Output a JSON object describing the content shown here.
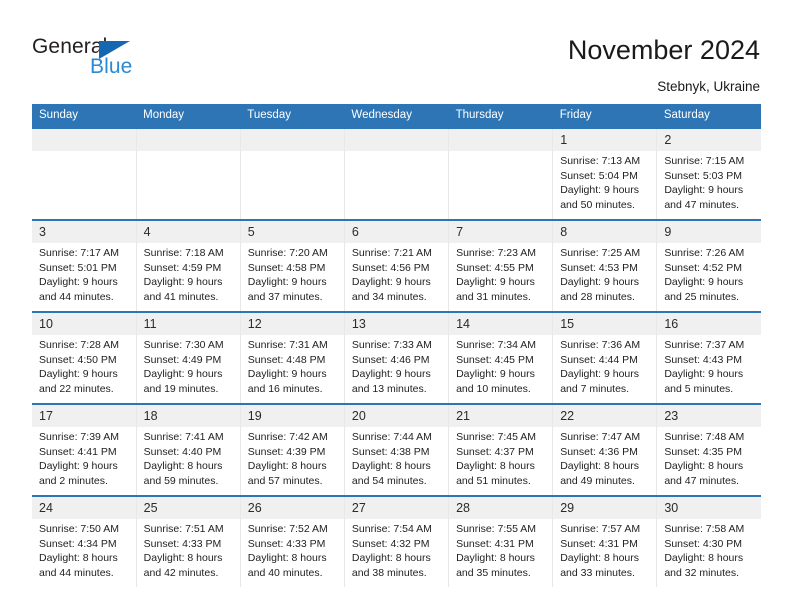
{
  "brand": {
    "name_part1": "General",
    "name_part2": "Blue",
    "triangle_color": "#1567b2",
    "blue_text_color": "#2a8ad4"
  },
  "header": {
    "title": "November 2024",
    "subtitle": "Stebnyk, Ukraine",
    "accent_color": "#2e75b6"
  },
  "weekday_headers": [
    "Sunday",
    "Monday",
    "Tuesday",
    "Wednesday",
    "Thursday",
    "Friday",
    "Saturday"
  ],
  "weeks": [
    [
      {
        "day": "",
        "info": ""
      },
      {
        "day": "",
        "info": ""
      },
      {
        "day": "",
        "info": ""
      },
      {
        "day": "",
        "info": ""
      },
      {
        "day": "",
        "info": ""
      },
      {
        "day": "1",
        "info": "Sunrise: 7:13 AM\nSunset: 5:04 PM\nDaylight: 9 hours\nand 50 minutes."
      },
      {
        "day": "2",
        "info": "Sunrise: 7:15 AM\nSunset: 5:03 PM\nDaylight: 9 hours\nand 47 minutes."
      }
    ],
    [
      {
        "day": "3",
        "info": "Sunrise: 7:17 AM\nSunset: 5:01 PM\nDaylight: 9 hours\nand 44 minutes."
      },
      {
        "day": "4",
        "info": "Sunrise: 7:18 AM\nSunset: 4:59 PM\nDaylight: 9 hours\nand 41 minutes."
      },
      {
        "day": "5",
        "info": "Sunrise: 7:20 AM\nSunset: 4:58 PM\nDaylight: 9 hours\nand 37 minutes."
      },
      {
        "day": "6",
        "info": "Sunrise: 7:21 AM\nSunset: 4:56 PM\nDaylight: 9 hours\nand 34 minutes."
      },
      {
        "day": "7",
        "info": "Sunrise: 7:23 AM\nSunset: 4:55 PM\nDaylight: 9 hours\nand 31 minutes."
      },
      {
        "day": "8",
        "info": "Sunrise: 7:25 AM\nSunset: 4:53 PM\nDaylight: 9 hours\nand 28 minutes."
      },
      {
        "day": "9",
        "info": "Sunrise: 7:26 AM\nSunset: 4:52 PM\nDaylight: 9 hours\nand 25 minutes."
      }
    ],
    [
      {
        "day": "10",
        "info": "Sunrise: 7:28 AM\nSunset: 4:50 PM\nDaylight: 9 hours\nand 22 minutes."
      },
      {
        "day": "11",
        "info": "Sunrise: 7:30 AM\nSunset: 4:49 PM\nDaylight: 9 hours\nand 19 minutes."
      },
      {
        "day": "12",
        "info": "Sunrise: 7:31 AM\nSunset: 4:48 PM\nDaylight: 9 hours\nand 16 minutes."
      },
      {
        "day": "13",
        "info": "Sunrise: 7:33 AM\nSunset: 4:46 PM\nDaylight: 9 hours\nand 13 minutes."
      },
      {
        "day": "14",
        "info": "Sunrise: 7:34 AM\nSunset: 4:45 PM\nDaylight: 9 hours\nand 10 minutes."
      },
      {
        "day": "15",
        "info": "Sunrise: 7:36 AM\nSunset: 4:44 PM\nDaylight: 9 hours\nand 7 minutes."
      },
      {
        "day": "16",
        "info": "Sunrise: 7:37 AM\nSunset: 4:43 PM\nDaylight: 9 hours\nand 5 minutes."
      }
    ],
    [
      {
        "day": "17",
        "info": "Sunrise: 7:39 AM\nSunset: 4:41 PM\nDaylight: 9 hours\nand 2 minutes."
      },
      {
        "day": "18",
        "info": "Sunrise: 7:41 AM\nSunset: 4:40 PM\nDaylight: 8 hours\nand 59 minutes."
      },
      {
        "day": "19",
        "info": "Sunrise: 7:42 AM\nSunset: 4:39 PM\nDaylight: 8 hours\nand 57 minutes."
      },
      {
        "day": "20",
        "info": "Sunrise: 7:44 AM\nSunset: 4:38 PM\nDaylight: 8 hours\nand 54 minutes."
      },
      {
        "day": "21",
        "info": "Sunrise: 7:45 AM\nSunset: 4:37 PM\nDaylight: 8 hours\nand 51 minutes."
      },
      {
        "day": "22",
        "info": "Sunrise: 7:47 AM\nSunset: 4:36 PM\nDaylight: 8 hours\nand 49 minutes."
      },
      {
        "day": "23",
        "info": "Sunrise: 7:48 AM\nSunset: 4:35 PM\nDaylight: 8 hours\nand 47 minutes."
      }
    ],
    [
      {
        "day": "24",
        "info": "Sunrise: 7:50 AM\nSunset: 4:34 PM\nDaylight: 8 hours\nand 44 minutes."
      },
      {
        "day": "25",
        "info": "Sunrise: 7:51 AM\nSunset: 4:33 PM\nDaylight: 8 hours\nand 42 minutes."
      },
      {
        "day": "26",
        "info": "Sunrise: 7:52 AM\nSunset: 4:33 PM\nDaylight: 8 hours\nand 40 minutes."
      },
      {
        "day": "27",
        "info": "Sunrise: 7:54 AM\nSunset: 4:32 PM\nDaylight: 8 hours\nand 38 minutes."
      },
      {
        "day": "28",
        "info": "Sunrise: 7:55 AM\nSunset: 4:31 PM\nDaylight: 8 hours\nand 35 minutes."
      },
      {
        "day": "29",
        "info": "Sunrise: 7:57 AM\nSunset: 4:31 PM\nDaylight: 8 hours\nand 33 minutes."
      },
      {
        "day": "30",
        "info": "Sunrise: 7:58 AM\nSunset: 4:30 PM\nDaylight: 8 hours\nand 32 minutes."
      }
    ]
  ]
}
